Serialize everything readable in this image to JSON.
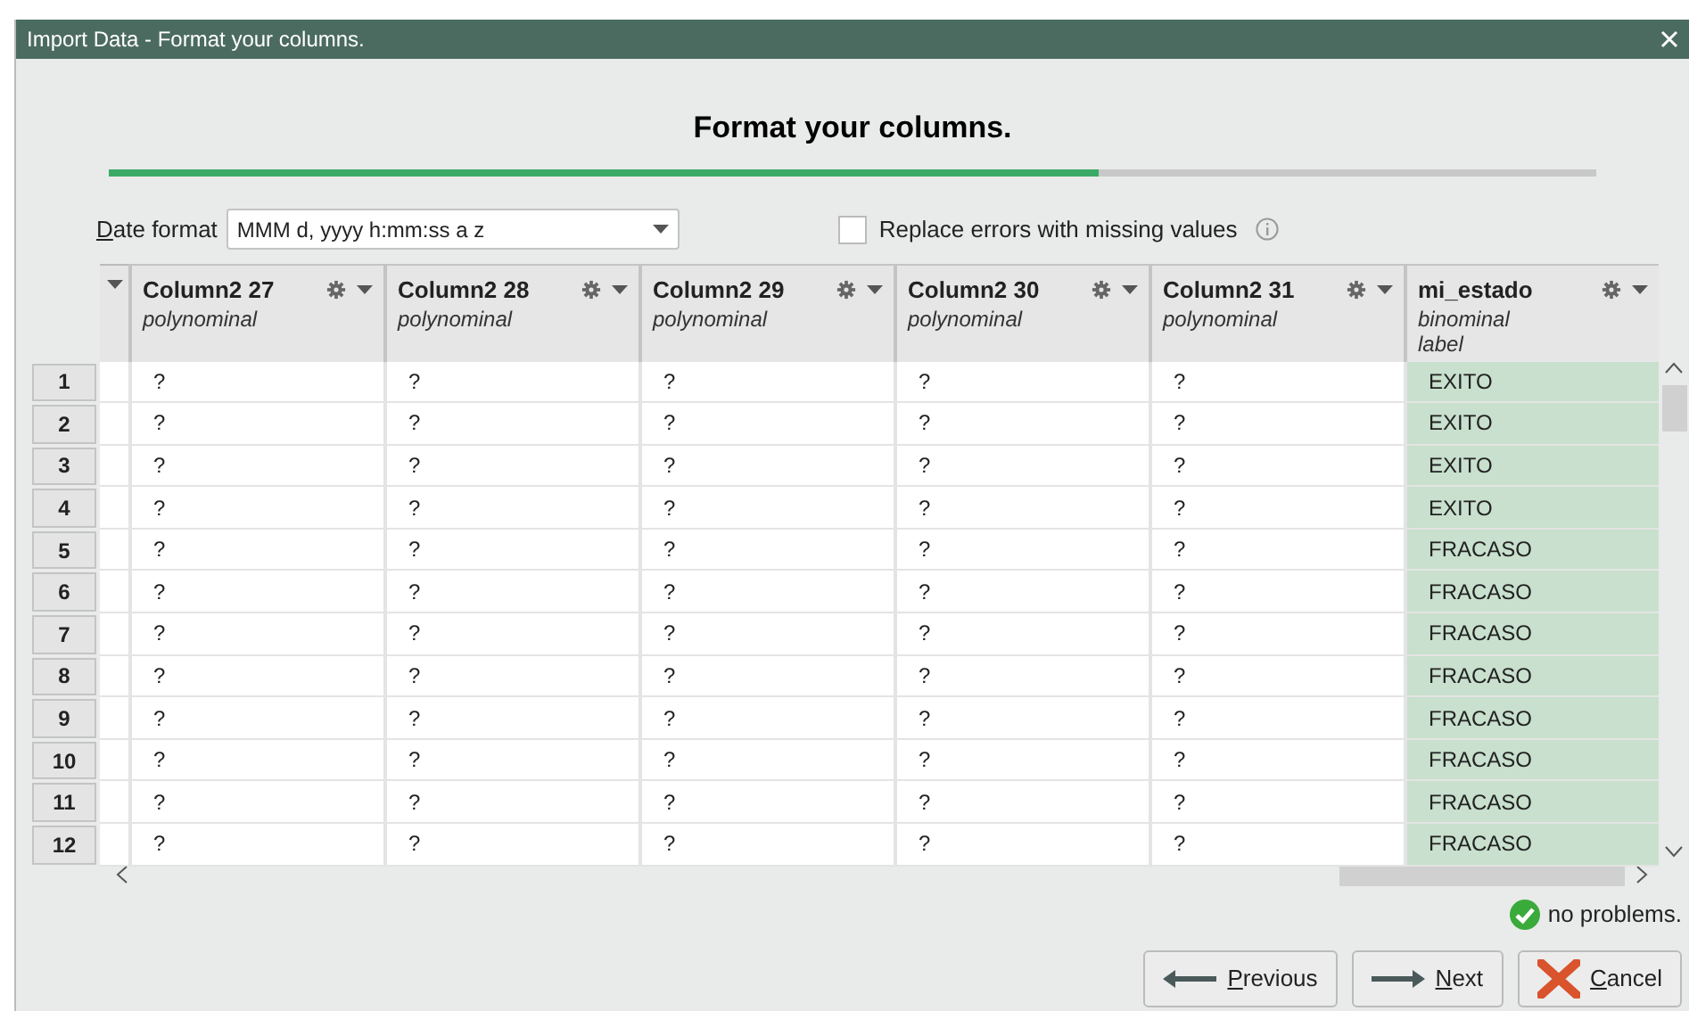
{
  "window": {
    "title": "Import Data - Format your columns."
  },
  "heading": "Format your columns.",
  "progress": {
    "level": 0.665
  },
  "date_format": {
    "label": "Date format",
    "underline_first": true,
    "value": "MMM d, yyyy h:mm:ss a z"
  },
  "replace_errors": {
    "label": "Replace errors with missing values",
    "checked": false
  },
  "table": {
    "columns": [
      {
        "name": "Column2 27",
        "type": "polynominal",
        "kind": "regular"
      },
      {
        "name": "Column2 28",
        "type": "polynominal",
        "kind": "regular"
      },
      {
        "name": "Column2 29",
        "type": "polynominal",
        "kind": "regular"
      },
      {
        "name": "Column2 30",
        "type": "polynominal",
        "kind": "regular"
      },
      {
        "name": "Column2 31",
        "type": "polynominal",
        "kind": "regular"
      },
      {
        "name": "mi_estado",
        "type": "binominal",
        "role": "label",
        "kind": "label"
      }
    ],
    "rows": [
      {
        "number": "1",
        "cells": [
          "?",
          "?",
          "?",
          "?",
          "?",
          "EXITO"
        ]
      },
      {
        "number": "2",
        "cells": [
          "?",
          "?",
          "?",
          "?",
          "?",
          "EXITO"
        ]
      },
      {
        "number": "3",
        "cells": [
          "?",
          "?",
          "?",
          "?",
          "?",
          "EXITO"
        ]
      },
      {
        "number": "4",
        "cells": [
          "?",
          "?",
          "?",
          "?",
          "?",
          "EXITO"
        ]
      },
      {
        "number": "5",
        "cells": [
          "?",
          "?",
          "?",
          "?",
          "?",
          "FRACASO"
        ]
      },
      {
        "number": "6",
        "cells": [
          "?",
          "?",
          "?",
          "?",
          "?",
          "FRACASO"
        ]
      },
      {
        "number": "7",
        "cells": [
          "?",
          "?",
          "?",
          "?",
          "?",
          "FRACASO"
        ]
      },
      {
        "number": "8",
        "cells": [
          "?",
          "?",
          "?",
          "?",
          "?",
          "FRACASO"
        ]
      },
      {
        "number": "9",
        "cells": [
          "?",
          "?",
          "?",
          "?",
          "?",
          "FRACASO"
        ]
      },
      {
        "number": "10",
        "cells": [
          "?",
          "?",
          "?",
          "?",
          "?",
          "FRACASO"
        ]
      },
      {
        "number": "11",
        "cells": [
          "?",
          "?",
          "?",
          "?",
          "?",
          "FRACASO"
        ]
      },
      {
        "number": "12",
        "cells": [
          "?",
          "?",
          "?",
          "?",
          "?",
          "FRACASO"
        ]
      }
    ]
  },
  "status": "no problems.",
  "buttons": [
    {
      "label": "Previous",
      "underline_first": true,
      "kind": "previous"
    },
    {
      "label": "Next",
      "underline_first": true,
      "kind": "next"
    },
    {
      "label": "Cancel",
      "underline_first": true,
      "kind": "cancel"
    }
  ]
}
